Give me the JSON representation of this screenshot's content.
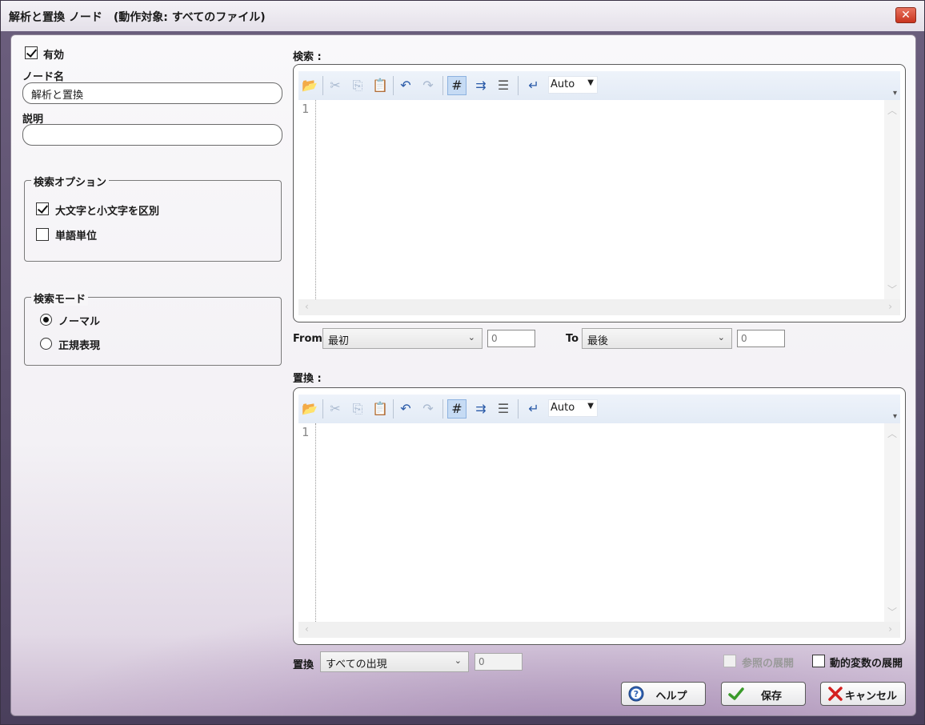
{
  "window": {
    "title": "解析と置換 ノード　(動作対象: すべてのファイル)",
    "close_icon": "close-icon"
  },
  "general": {
    "enabled_label": "有効",
    "enabled_checked": true,
    "node_name_label": "ノード名",
    "node_name_value": "解析と置換",
    "description_label": "説明",
    "description_value": ""
  },
  "search_options": {
    "title": "検索オプション",
    "case_sensitive_label": "大文字と小文字を区別",
    "case_sensitive_checked": true,
    "whole_word_label": "単語単位",
    "whole_word_checked": false
  },
  "search_mode": {
    "title": "検索モード",
    "normal_label": "ノーマル",
    "regex_label": "正規表現",
    "selected": "normal"
  },
  "search_editor": {
    "label": "検索 :",
    "line_number": "1",
    "encoding": "Auto"
  },
  "range": {
    "from_label": "From",
    "from_value": "最初",
    "from_number": "0",
    "to_label": "To",
    "to_value": "最後",
    "to_number": "0"
  },
  "replace_editor": {
    "label": "置換 :",
    "line_number": "1",
    "encoding": "Auto"
  },
  "replace_options": {
    "label": "置換",
    "occurrence_value": "すべての出現",
    "occurrence_number": "0",
    "expand_refs_label": "参照の展開",
    "expand_refs_checked": false,
    "expand_refs_enabled": false,
    "expand_vars_label": "動的変数の展開",
    "expand_vars_checked": false
  },
  "buttons": {
    "help_label": "ヘルプ",
    "save_label": "保存",
    "cancel_label": "キャンセル"
  },
  "toolbar_icons": [
    "open-folder-icon",
    "cut-icon",
    "copy-icon",
    "paste-icon",
    "undo-icon",
    "redo-icon",
    "line-number-icon",
    "whitespace-icon",
    "wrap-lines-icon",
    "enter-icon"
  ],
  "colors": {
    "accent": "#2a5aa8",
    "toolbar_bg": "#e3ebf6",
    "save_check": "#3a9a2a",
    "cancel_x": "#d42020"
  }
}
